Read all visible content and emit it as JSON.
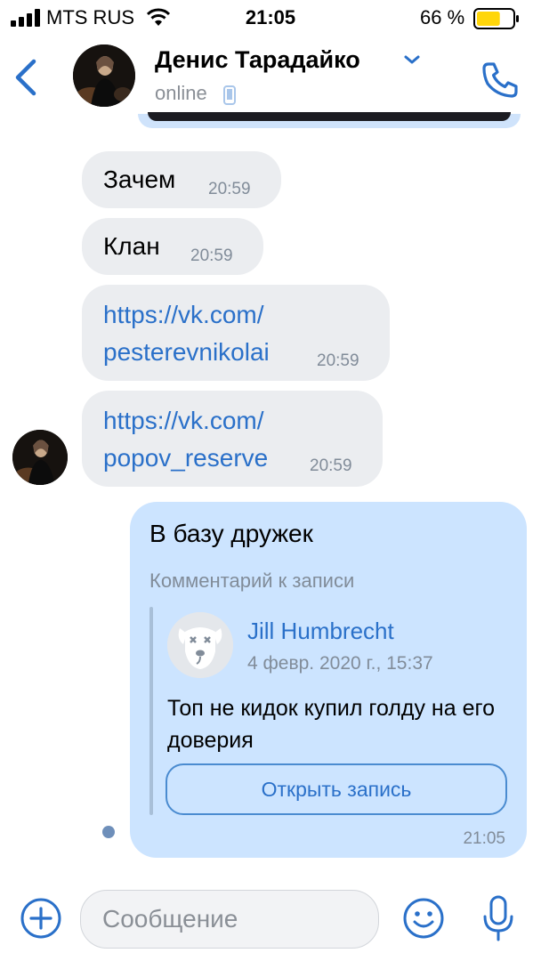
{
  "status_bar": {
    "carrier": "MTS RUS",
    "time": "21:05",
    "battery_percent": "66 %",
    "battery_level": 0.66
  },
  "header": {
    "contact_name": "Денис Тарадайко",
    "presence": "online"
  },
  "messages": [
    {
      "direction": "in",
      "text": "Зачем",
      "time": "20:59"
    },
    {
      "direction": "in",
      "text": "Клан",
      "time": "20:59"
    },
    {
      "direction": "in",
      "link_lines": [
        "https://vk.com/",
        "pesterevnikolai"
      ],
      "time": "20:59"
    },
    {
      "direction": "in",
      "link_lines": [
        "https://vk.com/",
        "popov_reserve"
      ],
      "time": "20:59"
    }
  ],
  "outgoing": {
    "text": "В базу дружек",
    "caption": "Комментарий к записи",
    "post": {
      "author": "Jill Humbrecht",
      "date": "4 февр. 2020 г., 15:37",
      "text": "Топ не кидок купил голду на его доверия",
      "open_button": "Открыть запись"
    },
    "time": "21:05"
  },
  "composer": {
    "placeholder": "Сообщение"
  },
  "colors": {
    "accent": "#2a70c9",
    "incoming_bubble": "#ebedf0",
    "outgoing_bubble": "#cce4ff",
    "battery": "#ffd60a"
  }
}
